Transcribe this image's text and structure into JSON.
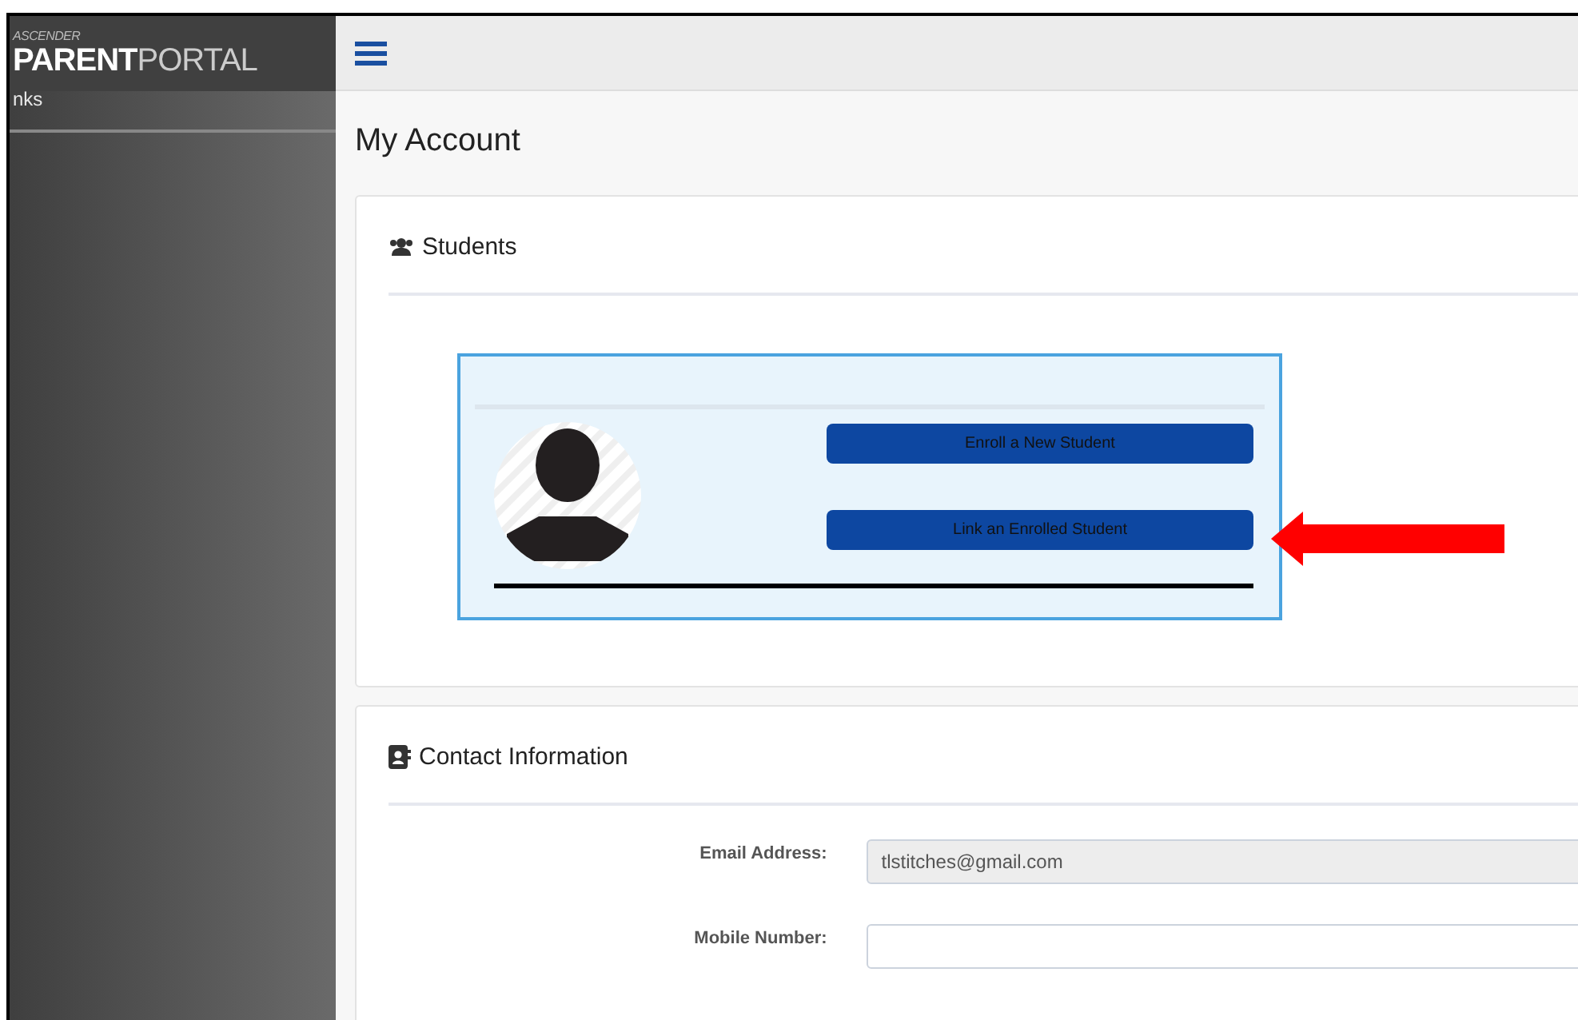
{
  "sidebar": {
    "logo": {
      "top": "ASCENDER",
      "bold": "PARENT",
      "light": "PORTAL"
    },
    "cut_item": "nks"
  },
  "page_title": "My Account",
  "students": {
    "heading": "Students",
    "buttons": [
      "Enroll a New Student",
      "Link an Enrolled Student"
    ]
  },
  "contact": {
    "heading": "Contact Information",
    "fields": [
      {
        "label": "Email Address:",
        "value": "tlstitches@gmail.com",
        "disabled": true
      },
      {
        "label": "Mobile Number:",
        "disabled": false
      }
    ]
  }
}
